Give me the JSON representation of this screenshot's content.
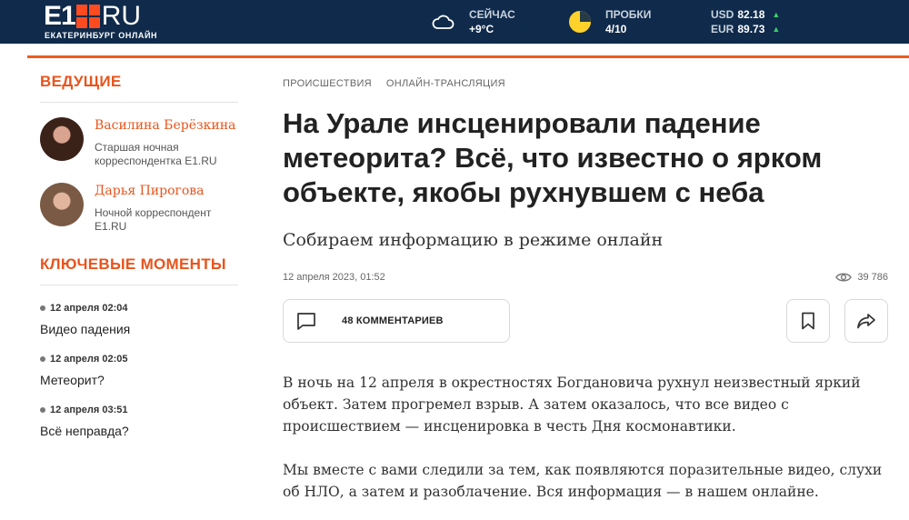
{
  "header": {
    "logo": {
      "mark": "E1",
      "ru": "RU",
      "city": "ЕКАТЕРИНБУРГ ОНЛАЙН"
    },
    "weather": {
      "icon": "cloud-icon",
      "label": "СЕЙЧАС",
      "value": "+9°C"
    },
    "traffic": {
      "icon": "traffic-circle-icon",
      "label": "ПРОБКИ",
      "value": "4/10",
      "color": "#ffd22b"
    },
    "currency": [
      {
        "code": "USD",
        "value": "82.18",
        "trend": "▲"
      },
      {
        "code": "EUR",
        "value": "89.73",
        "trend": "▲"
      }
    ]
  },
  "colors": {
    "header_bg": "#0f2a4a",
    "accent": "#e8541c",
    "trend_up": "#3ccf6a"
  },
  "sidebar": {
    "hosts_title": "ВЕДУЩИЕ",
    "authors": [
      {
        "name": "Василина Берёзкина",
        "role": "Старшая ночная корреспондентка E1.RU"
      },
      {
        "name": "Дарья Пирогова",
        "role": "Ночной корреспондент E1.RU"
      }
    ],
    "moments_title": "КЛЮЧЕВЫЕ МОМЕНТЫ",
    "moments": [
      {
        "time": "12 апреля 02:04",
        "text": "Видео падения"
      },
      {
        "time": "12 апреля 02:05",
        "text": "Метеорит?"
      },
      {
        "time": "12 апреля 03:51",
        "text": "Всё неправда?"
      }
    ]
  },
  "article": {
    "tags": [
      "ПРОИСШЕСТВИЯ",
      "ОНЛАЙН-ТРАНСЛЯЦИЯ"
    ],
    "title": "На Урале инсценировали падение метеорита? Всё, что известно о ярком объекте, якобы рухнувшем с неба",
    "subtitle": "Собираем информацию в режиме онлайн",
    "date": "12 апреля 2023, 01:52",
    "views": "39 786",
    "comments_label": "48 КОММЕНТАРИЕВ",
    "paragraphs": [
      "В ночь на 12 апреля в окрестностях Богдановича рухнул неизвестный яркий объект. Затем прогремел взрыв. А затем оказалось, что все видео с происшествием — инсценировка в честь Дня космонавтики.",
      "Мы вместе с вами следили за тем, как появляются поразительные видео, слухи об НЛО, а затем и разоблачение. Вся информация — в нашем онлайне."
    ]
  }
}
